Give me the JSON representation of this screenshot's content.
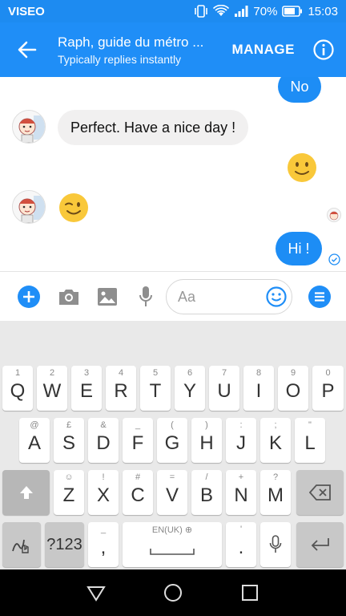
{
  "status_bar": {
    "carrier": "VISEO",
    "battery": "70%",
    "time": "15:03"
  },
  "header": {
    "title": "Raph, guide du métro ...",
    "subtitle": "Typically replies instantly",
    "manage_label": "MANAGE"
  },
  "messages": [
    {
      "from": "me",
      "text": "No"
    },
    {
      "from": "them",
      "text": "Perfect. Have a nice day !"
    },
    {
      "from": "me",
      "emoji": "slight-smile"
    },
    {
      "from": "them",
      "emoji": "wink"
    },
    {
      "from": "me",
      "text": "Hi !"
    }
  ],
  "composer": {
    "placeholder": "Aa"
  },
  "keyboard": {
    "row1": [
      {
        "key": "Q",
        "hint": "1"
      },
      {
        "key": "W",
        "hint": "2"
      },
      {
        "key": "E",
        "hint": "3"
      },
      {
        "key": "R",
        "hint": "4"
      },
      {
        "key": "T",
        "hint": "5"
      },
      {
        "key": "Y",
        "hint": "6"
      },
      {
        "key": "U",
        "hint": "7"
      },
      {
        "key": "I",
        "hint": "8"
      },
      {
        "key": "O",
        "hint": "9"
      },
      {
        "key": "P",
        "hint": "0"
      }
    ],
    "row2": [
      {
        "key": "A",
        "hint": "@"
      },
      {
        "key": "S",
        "hint": "£"
      },
      {
        "key": "D",
        "hint": "&"
      },
      {
        "key": "F",
        "hint": "_"
      },
      {
        "key": "G",
        "hint": "("
      },
      {
        "key": "H",
        "hint": ")"
      },
      {
        "key": "J",
        "hint": ":"
      },
      {
        "key": "K",
        "hint": ";"
      },
      {
        "key": "L",
        "hint": "\""
      }
    ],
    "row3": [
      {
        "key": "Z",
        "hint": "☺"
      },
      {
        "key": "X",
        "hint": "!"
      },
      {
        "key": "C",
        "hint": "#"
      },
      {
        "key": "V",
        "hint": "="
      },
      {
        "key": "B",
        "hint": "/"
      },
      {
        "key": "N",
        "hint": "+"
      },
      {
        "key": "M",
        "hint": "?"
      }
    ],
    "row4": {
      "symbols_label": "?123",
      "comma": ",",
      "comma_hint": "_",
      "space_hint": "EN(UK) ⊕",
      "period": ".",
      "period_hint": "'"
    }
  },
  "colors": {
    "brand": "#1f8ef7",
    "bubble_out": "#1d8df5",
    "bubble_in": "#f1f0f0"
  }
}
